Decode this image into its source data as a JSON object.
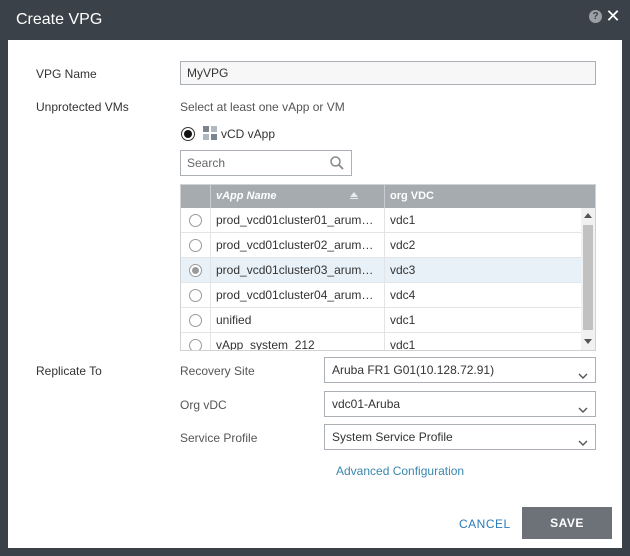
{
  "dialog": {
    "title": "Create VPG",
    "help_icon": "question-icon",
    "help_glyph": "?",
    "close_icon": "close-icon",
    "close_glyph": "✕"
  },
  "form": {
    "vpg_name_label": "VPG Name",
    "vpg_name_value": "MyVPG",
    "unprotected_label": "Unprotected VMs",
    "unprotected_hint": "Select at least one vApp or VM",
    "vcd_vapp_option": "vCD vApp",
    "vcd_vapp_selected": true,
    "search_placeholder": "Search"
  },
  "grid": {
    "columns": [
      "vApp Name",
      "org VDC"
    ],
    "sort_column": "vApp Name",
    "sort_direction": "ascending",
    "rows": [
      {
        "name": "prod_vcd01cluster01_arum…",
        "org": "vdc1",
        "selected": false
      },
      {
        "name": "prod_vcd01cluster02_arum…",
        "org": "vdc2",
        "selected": false
      },
      {
        "name": "prod_vcd01cluster03_arum…",
        "org": "vdc3",
        "selected": true
      },
      {
        "name": "prod_vcd01cluster04_arum…",
        "org": "vdc4",
        "selected": false
      },
      {
        "name": "unified",
        "org": "vdc1",
        "selected": false
      },
      {
        "name": "vApp_system_212",
        "org": "vdc1",
        "selected": false
      }
    ]
  },
  "replicate": {
    "label": "Replicate To",
    "recovery_site_label": "Recovery Site",
    "recovery_site_value": "Aruba FR1 G01(10.128.72.91)",
    "org_vdc_label": "Org vDC",
    "org_vdc_value": "vdc01-Aruba",
    "service_profile_label": "Service Profile",
    "service_profile_value": "System Service Profile",
    "advanced_link": "Advanced Configuration"
  },
  "footer": {
    "cancel_label": "CANCEL",
    "save_label": "SAVE"
  },
  "colors": {
    "titlebar": "#3b4148",
    "grid_header": "#a6abb0",
    "selected_row": "#e8f1f8",
    "link": "#3a87ad",
    "save_button": "#6d7278"
  }
}
